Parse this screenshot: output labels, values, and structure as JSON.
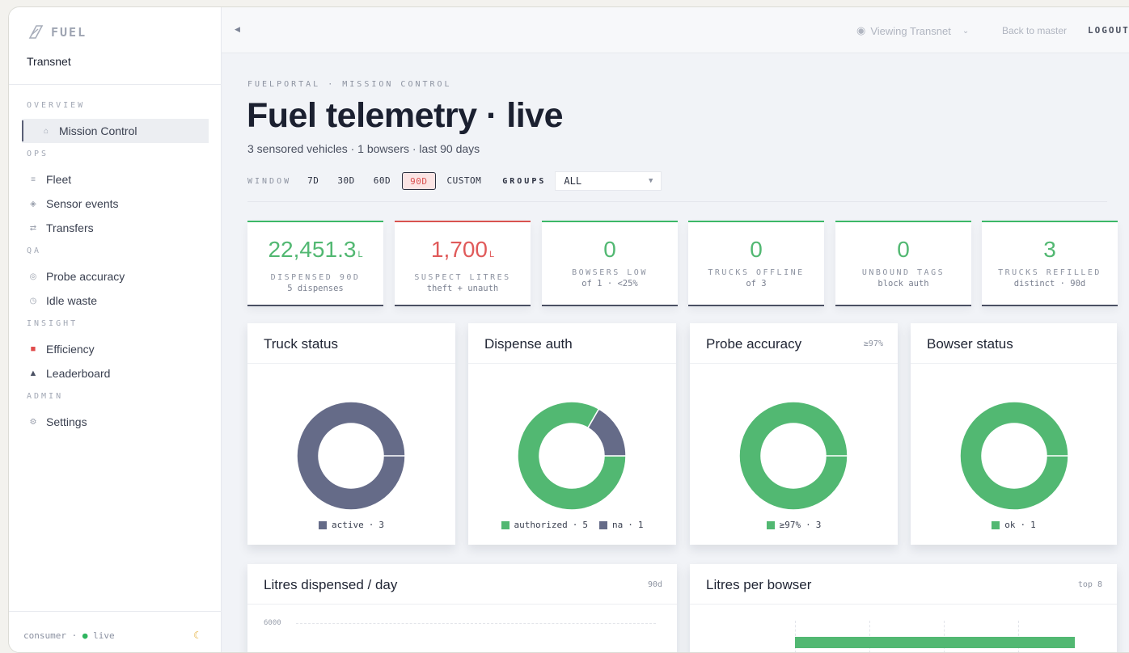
{
  "brand": {
    "name": "FUEL",
    "org": "Transnet"
  },
  "sidebar": {
    "sections": [
      {
        "title": "OVERVIEW",
        "items": [
          {
            "label": "Mission Control",
            "icon": "home-icon"
          }
        ]
      },
      {
        "title": "OPS",
        "items": [
          {
            "label": "Fleet",
            "icon": "list-icon"
          },
          {
            "label": "Sensor events",
            "icon": "diamond-icon"
          },
          {
            "label": "Transfers",
            "icon": "swap-icon"
          }
        ]
      },
      {
        "title": "QA",
        "items": [
          {
            "label": "Probe accuracy",
            "icon": "target-icon"
          },
          {
            "label": "Idle waste",
            "icon": "clock-icon"
          }
        ]
      },
      {
        "title": "INSIGHT",
        "items": [
          {
            "label": "Efficiency",
            "icon": "fuel-pump-icon"
          },
          {
            "label": "Leaderboard",
            "icon": "triangle-icon"
          }
        ]
      },
      {
        "title": "ADMIN",
        "items": [
          {
            "label": "Settings",
            "icon": "gear-icon"
          }
        ]
      }
    ],
    "footer": {
      "mode": "consumer",
      "sep": "·",
      "dot": "●",
      "status": "live"
    }
  },
  "topbar": {
    "viewing": "Viewing Transnet",
    "back": "Back to master",
    "logout": "LOGOUT"
  },
  "page": {
    "breadcrumb": "FUELPORTAL · MISSION CONTROL",
    "title": "Fuel telemetry · live",
    "subtitle": "3 sensored vehicles · 1 bowsers · last 90 days"
  },
  "filters": {
    "window_label": "WINDOW",
    "windows": [
      "7D",
      "30D",
      "60D",
      "90D",
      "CUSTOM"
    ],
    "active_window": "90D",
    "groups_label": "GROUPS",
    "groups_value": "ALL"
  },
  "kpis": [
    {
      "value": "22,451.3",
      "unit": "L",
      "label": "DISPENSED 90D",
      "sub": "5 dispenses",
      "tone": "green"
    },
    {
      "value": "1,700",
      "unit": "L",
      "label": "SUSPECT LITRES",
      "sub": "theft + unauth",
      "tone": "red"
    },
    {
      "value": "0",
      "unit": "",
      "label": "BOWSERS LOW",
      "sub": "of 1 · <25%",
      "tone": "green"
    },
    {
      "value": "0",
      "unit": "",
      "label": "TRUCKS OFFLINE",
      "sub": "of 3",
      "tone": "green"
    },
    {
      "value": "0",
      "unit": "",
      "label": "UNBOUND TAGS",
      "sub": "block auth",
      "tone": "green"
    },
    {
      "value": "3",
      "unit": "",
      "label": "TRUCKS REFILLED",
      "sub": "distinct · 90d",
      "tone": "green"
    }
  ],
  "colors": {
    "green": "#52b872",
    "slate": "#656b88",
    "red": "#d9534f"
  },
  "donuts": [
    {
      "title": "Truck status",
      "meta": "",
      "chart_data": {
        "type": "pie",
        "labels": [
          "active"
        ],
        "values": [
          3
        ],
        "colors": [
          "#656b88"
        ]
      }
    },
    {
      "title": "Dispense auth",
      "meta": "",
      "chart_data": {
        "type": "pie",
        "labels": [
          "authorized",
          "na"
        ],
        "values": [
          5,
          1
        ],
        "colors": [
          "#52b872",
          "#656b88"
        ]
      }
    },
    {
      "title": "Probe accuracy",
      "meta": "≥97%",
      "chart_data": {
        "type": "pie",
        "labels": [
          "≥97%"
        ],
        "values": [
          3
        ],
        "colors": [
          "#52b872"
        ]
      }
    },
    {
      "title": "Bowser status",
      "meta": "",
      "chart_data": {
        "type": "pie",
        "labels": [
          "ok"
        ],
        "values": [
          1
        ],
        "colors": [
          "#52b872"
        ]
      }
    }
  ],
  "lower": {
    "left": {
      "title": "Litres dispensed / day",
      "meta": "90d",
      "y_tick": "6000"
    },
    "right": {
      "title": "Litres per bowser",
      "meta": "top 8"
    }
  }
}
